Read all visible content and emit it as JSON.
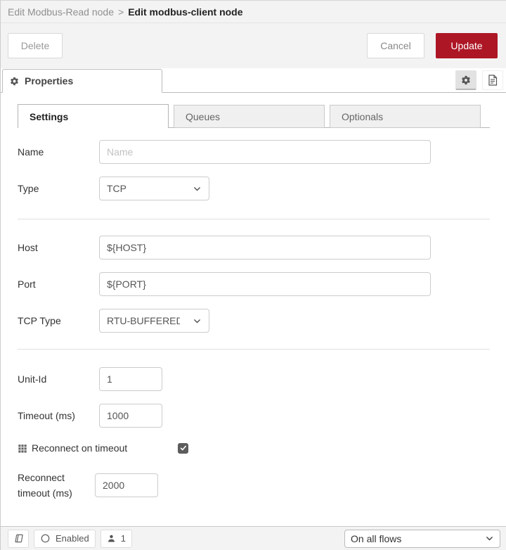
{
  "colors": {
    "accent_red": "#AD1625",
    "header_bg": "#f3f3f3",
    "border": "#bbbbbb",
    "checkbox_checked": "#5c5c5c"
  },
  "breadcrumb": {
    "parent": "Edit Modbus-Read node",
    "separator": ">",
    "current": "Edit modbus-client node"
  },
  "actions": {
    "delete_label": "Delete",
    "cancel_label": "Cancel",
    "update_label": "Update"
  },
  "tray": {
    "properties_tab_label": "Properties",
    "icons": {
      "properties": "gear",
      "settings_toggle": "gear",
      "node_info": "document"
    }
  },
  "tabs": [
    {
      "label": "Settings",
      "active": true
    },
    {
      "label": "Queues",
      "active": false
    },
    {
      "label": "Optionals",
      "active": false
    }
  ],
  "form": {
    "name": {
      "label": "Name",
      "placeholder": "Name",
      "value": ""
    },
    "type": {
      "label": "Type",
      "value": "TCP"
    },
    "host": {
      "label": "Host",
      "value": "${HOST}"
    },
    "port": {
      "label": "Port",
      "value": "${PORT}"
    },
    "tcp_type": {
      "label": "TCP Type",
      "value": "RTU-BUFFERED"
    },
    "unit_id": {
      "label": "Unit-Id",
      "value": "1"
    },
    "timeout": {
      "label": "Timeout (ms)",
      "value": "1000"
    },
    "reconnect_on_timeout": {
      "label": "Reconnect on timeout",
      "checked": true,
      "icon": "grid"
    },
    "reconnect_timeout": {
      "label": "Reconnect timeout (ms)",
      "value": "2000"
    }
  },
  "footer": {
    "docs_icon": "book",
    "enabled": {
      "icon": "circle-outline",
      "label": "Enabled"
    },
    "instances": {
      "icon": "person",
      "count": "1"
    },
    "scope_select": {
      "value": "On all flows",
      "icon": "chevron-down"
    }
  }
}
